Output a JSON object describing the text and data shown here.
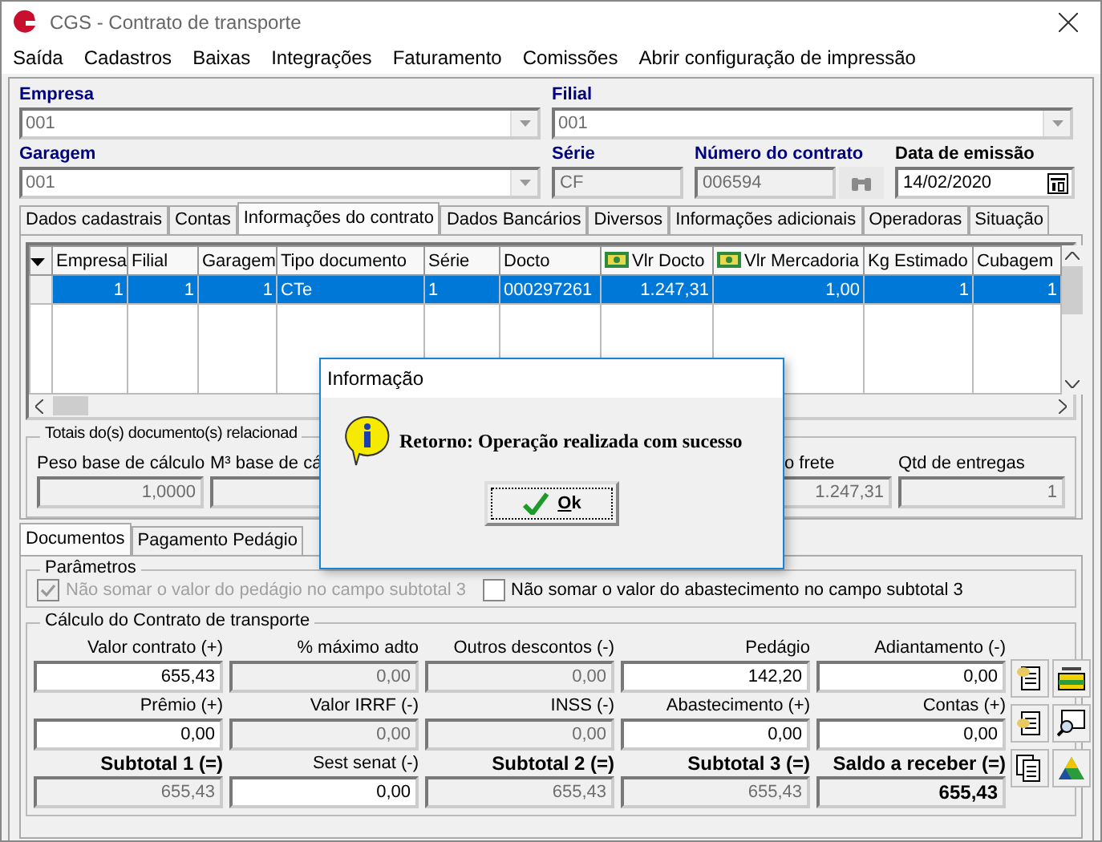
{
  "window": {
    "title": "CGS - Contrato de transporte"
  },
  "menu": [
    "Saída",
    "Cadastros",
    "Baixas",
    "Integrações",
    "Faturamento",
    "Comissões",
    "Abrir configuração de impressão"
  ],
  "header": {
    "empresa": {
      "label": "Empresa",
      "value": "001"
    },
    "filial": {
      "label": "Filial",
      "value": "001"
    },
    "garagem": {
      "label": "Garagem",
      "value": "001"
    },
    "serie": {
      "label": "Série",
      "value": "CF"
    },
    "numero": {
      "label": "Número do contrato",
      "value": "006594"
    },
    "data": {
      "label": "Data de emissão",
      "value": "14/02/2020"
    }
  },
  "tabs": [
    {
      "label": "Dados cadastrais",
      "selected": false
    },
    {
      "label": "Contas",
      "selected": false
    },
    {
      "label": "Informações do contrato",
      "selected": true
    },
    {
      "label": "Dados Bancários",
      "selected": false
    },
    {
      "label": "Diversos",
      "selected": false
    },
    {
      "label": "Informações adicionais",
      "selected": false
    },
    {
      "label": "Operadoras",
      "selected": false
    },
    {
      "label": "Situação",
      "selected": false
    }
  ],
  "grid": {
    "columns": [
      {
        "label": "Empresa",
        "kind": "number"
      },
      {
        "label": "Filial",
        "kind": "number"
      },
      {
        "label": "Garagem",
        "kind": "number"
      },
      {
        "label": "Tipo documento",
        "kind": "text"
      },
      {
        "label": "Série",
        "kind": "text"
      },
      {
        "label": "Docto",
        "kind": "text"
      },
      {
        "label": "Vlr Docto",
        "kind": "money"
      },
      {
        "label": "Vlr Mercadoria",
        "kind": "money"
      },
      {
        "label": "Kg Estimado",
        "kind": "number"
      },
      {
        "label": "Cubagem",
        "kind": "number"
      }
    ],
    "rows": [
      {
        "selected": true,
        "cells": [
          "1",
          "1",
          "1",
          "CTe",
          "1",
          "000297261",
          "1.247,31",
          "1,00",
          "1",
          "1"
        ]
      }
    ]
  },
  "totals": {
    "title": "Totais do(s) documento(s) relacionad",
    "fields": [
      {
        "label": "Peso base de cálculo",
        "value": "1,0000"
      },
      {
        "label": "M³ base de cá"
      },
      {
        "label": "o frete",
        "value": "1.247,31"
      },
      {
        "label": "Qtd de entregas",
        "value": "1"
      }
    ]
  },
  "bottom_tabs": [
    {
      "label": "Documentos",
      "selected": true
    },
    {
      "label": "Pagamento Pedágio",
      "selected": false
    }
  ],
  "parameters": {
    "title": "Parâmetros",
    "options": [
      {
        "label": "Não somar o valor do pedágio no campo subtotal 3",
        "checked": true,
        "disabled": true
      },
      {
        "label": "Não somar o valor do abastecimento no campo subtotal 3",
        "checked": false,
        "disabled": false
      }
    ]
  },
  "calculo": {
    "title": "Cálculo do Contrato de transporte",
    "fields": [
      {
        "label": "Valor contrato (+)",
        "value": "655,43",
        "disabled": false,
        "label_bold": false,
        "value_bold": false
      },
      {
        "label": "% máximo adto",
        "value": "0,00",
        "disabled": true,
        "label_bold": false,
        "value_bold": false
      },
      {
        "label": "Outros descontos (-)",
        "value": "0,00",
        "disabled": true,
        "label_bold": false,
        "value_bold": false
      },
      {
        "label": "Pedágio",
        "value": "142,20",
        "disabled": false,
        "label_bold": false,
        "value_bold": false
      },
      {
        "label": "Adiantamento (-)",
        "value": "0,00",
        "disabled": false,
        "label_bold": false,
        "value_bold": false
      },
      {
        "label": "Prêmio (+)",
        "value": "0,00",
        "disabled": false,
        "label_bold": false,
        "value_bold": false
      },
      {
        "label": "Valor IRRF (-)",
        "value": "0,00",
        "disabled": true,
        "label_bold": false,
        "value_bold": false
      },
      {
        "label": "INSS (-)",
        "value": "0,00",
        "disabled": true,
        "label_bold": false,
        "value_bold": false
      },
      {
        "label": "Abastecimento (+)",
        "value": "0,00",
        "disabled": false,
        "label_bold": false,
        "value_bold": false
      },
      {
        "label": "Contas (+)",
        "value": "0,00",
        "disabled": false,
        "label_bold": false,
        "value_bold": false
      },
      {
        "label": "Subtotal 1 (=)",
        "value": "655,43",
        "disabled": true,
        "label_bold": true,
        "value_bold": false
      },
      {
        "label": "Sest senat (-)",
        "value": "0,00",
        "disabled": false,
        "label_bold": false,
        "value_bold": false
      },
      {
        "label": "Subtotal 2 (=)",
        "value": "655,43",
        "disabled": true,
        "label_bold": true,
        "value_bold": false
      },
      {
        "label": "Subtotal 3 (=)",
        "value": "655,43",
        "disabled": true,
        "label_bold": true,
        "value_bold": false
      },
      {
        "label": "Saldo a receber (=)",
        "value": "655,43",
        "disabled": true,
        "label_bold": true,
        "value_bold": true
      }
    ]
  },
  "dialog": {
    "title": "Informação",
    "message": "Retorno: Operação realizada com sucesso",
    "button": "Ok"
  }
}
